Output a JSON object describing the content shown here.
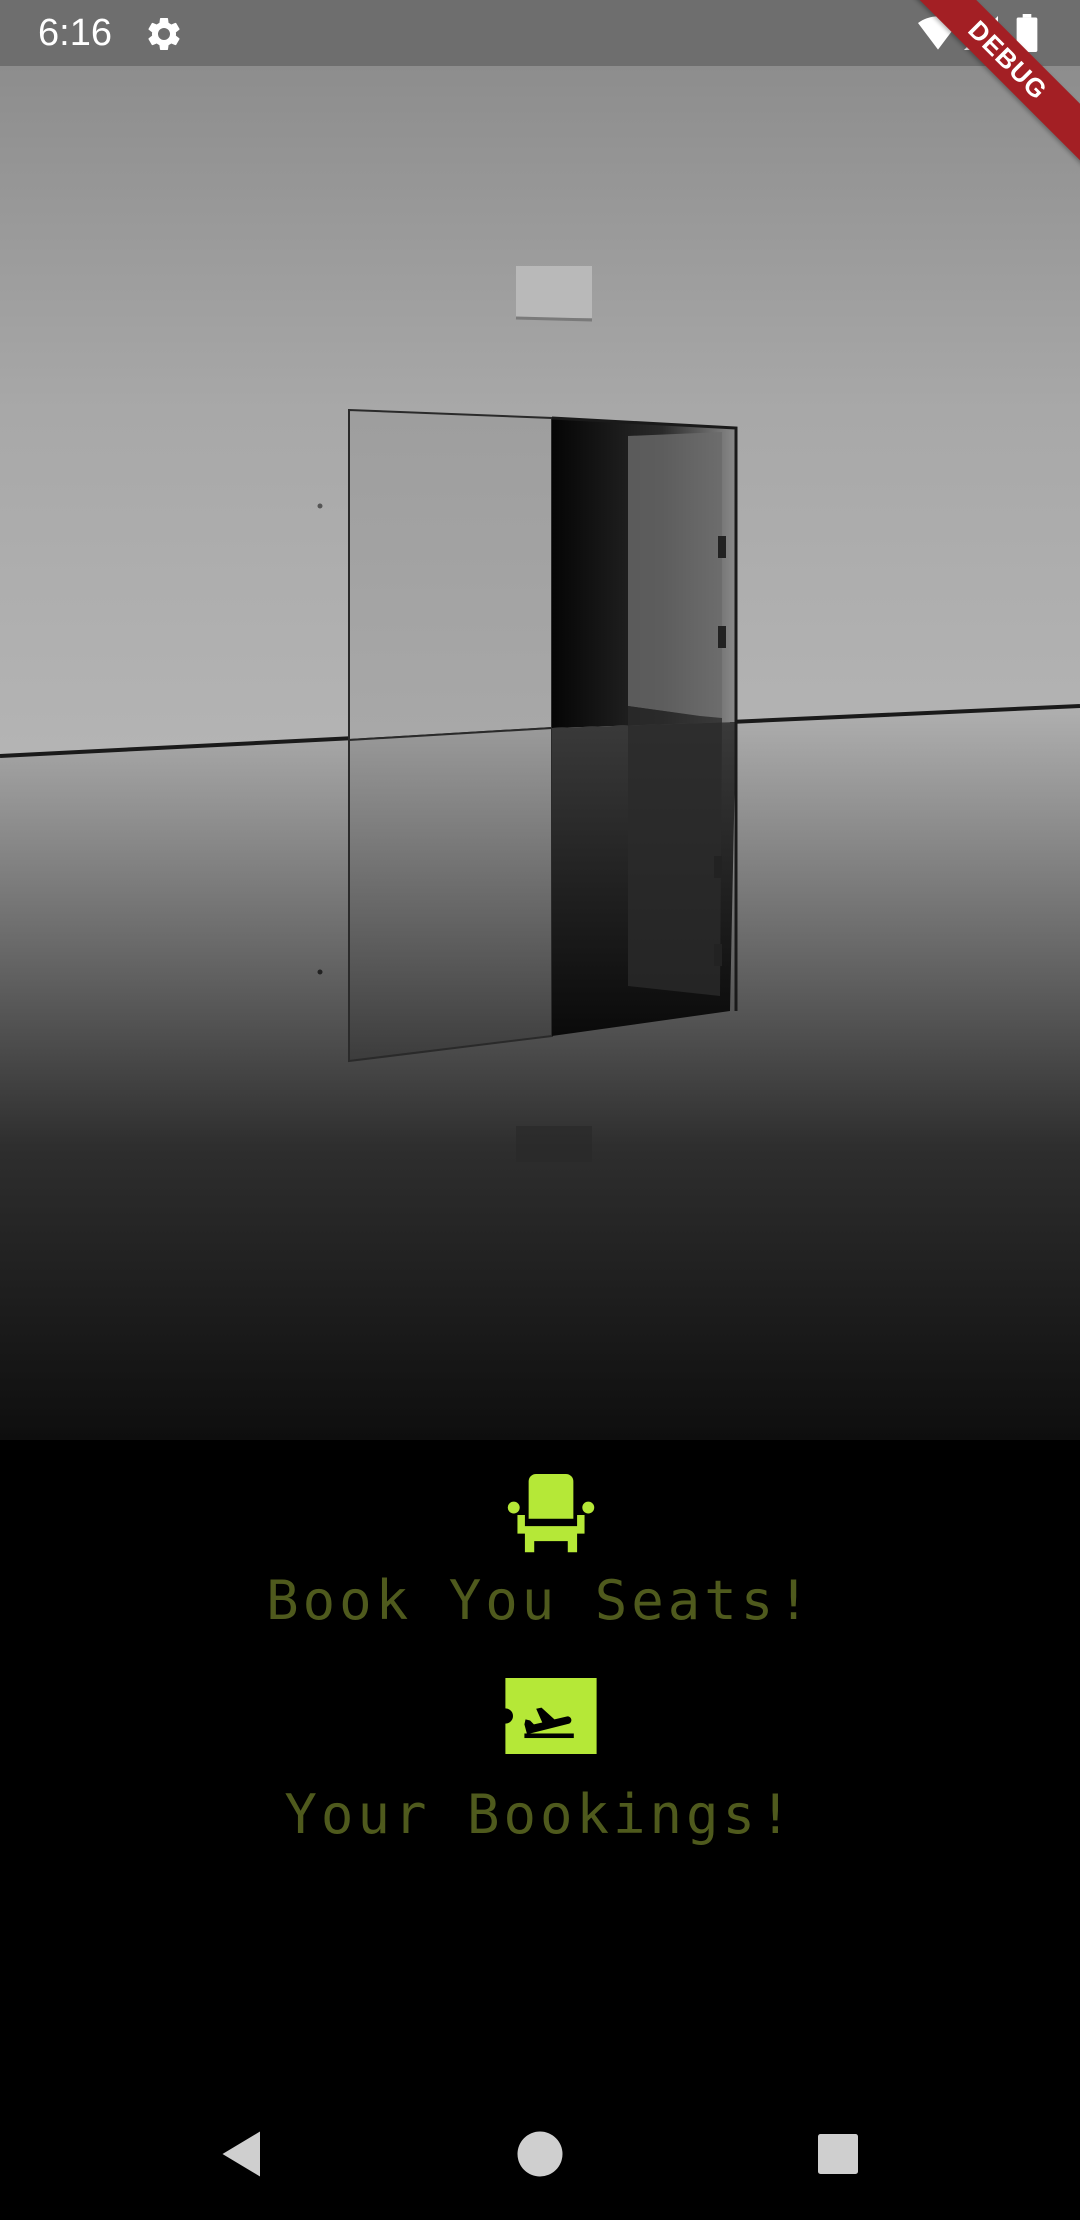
{
  "status_bar": {
    "time": "6:16",
    "icons": [
      "gear-icon",
      "wifi-icon",
      "signal-icon",
      "battery-icon"
    ]
  },
  "debug_banner": {
    "label": "DEBUG",
    "color": "#a31f24"
  },
  "hero": {
    "description_icon": "door-photo"
  },
  "menu": {
    "items": [
      {
        "label": "Book You Seats!",
        "icon": "seat-icon"
      },
      {
        "label": "Your Bookings!",
        "icon": "flight-ticket-icon"
      }
    ]
  },
  "theme": {
    "accent": "#b5e837",
    "label_color": "#4f5a1d",
    "background": "#000000"
  },
  "nav_bar": {
    "buttons": [
      "back-icon",
      "home-icon",
      "recents-icon"
    ]
  }
}
